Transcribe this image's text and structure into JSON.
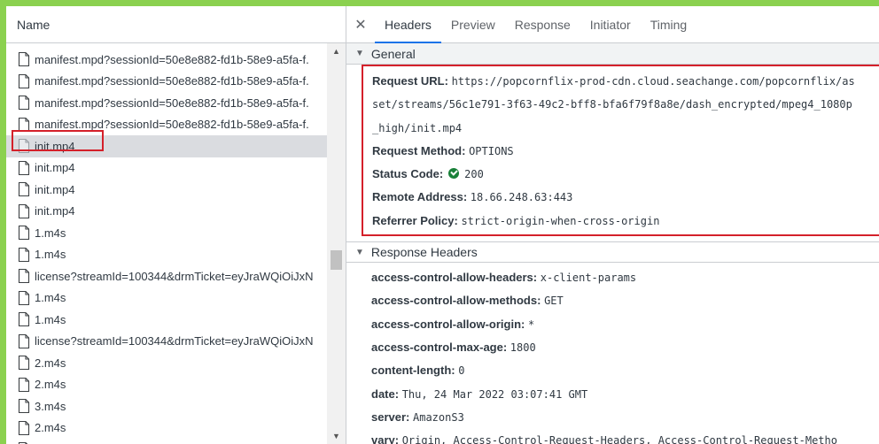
{
  "left": {
    "column_name": "Name",
    "requests": [
      {
        "name": "manifest.mpd?sessionId=50e8e882-fd1b-58e9-a5fa-f.",
        "selected": false
      },
      {
        "name": "manifest.mpd?sessionId=50e8e882-fd1b-58e9-a5fa-f.",
        "selected": false
      },
      {
        "name": "manifest.mpd?sessionId=50e8e882-fd1b-58e9-a5fa-f.",
        "selected": false
      },
      {
        "name": "manifest.mpd?sessionId=50e8e882-fd1b-58e9-a5fa-f.",
        "selected": false
      },
      {
        "name": "init.mp4",
        "selected": true
      },
      {
        "name": "init.mp4",
        "selected": false
      },
      {
        "name": "init.mp4",
        "selected": false
      },
      {
        "name": "init.mp4",
        "selected": false
      },
      {
        "name": "1.m4s",
        "selected": false
      },
      {
        "name": "1.m4s",
        "selected": false
      },
      {
        "name": "license?streamId=100344&drmTicket=eyJraWQiOiJxN",
        "selected": false
      },
      {
        "name": "1.m4s",
        "selected": false
      },
      {
        "name": "1.m4s",
        "selected": false
      },
      {
        "name": "license?streamId=100344&drmTicket=eyJraWQiOiJxN",
        "selected": false
      },
      {
        "name": "2.m4s",
        "selected": false
      },
      {
        "name": "2.m4s",
        "selected": false
      },
      {
        "name": "3.m4s",
        "selected": false
      },
      {
        "name": "2.m4s",
        "selected": false
      },
      {
        "name": "2.m4s",
        "selected": false
      }
    ]
  },
  "tabs": {
    "close": "✕",
    "headers": "Headers",
    "preview": "Preview",
    "response": "Response",
    "initiator": "Initiator",
    "timing": "Timing"
  },
  "general": {
    "title": "General",
    "request_url_label": "Request URL:",
    "request_url_line1": "https://popcornflix-prod-cdn.cloud.seachange.com/popcornflix/as",
    "request_url_line2": "set/streams/56c1e791-3f63-49c2-bff8-bfa6f79f8a8e/dash_encrypted/mpeg4_1080p",
    "request_url_line3": "_high/init.mp4",
    "method_label": "Request Method:",
    "method_value": "OPTIONS",
    "status_label": "Status Code:",
    "status_value": "200",
    "remote_label": "Remote Address:",
    "remote_value": "18.66.248.63:443",
    "referrer_label": "Referrer Policy:",
    "referrer_value": "strict-origin-when-cross-origin"
  },
  "response_headers": {
    "title": "Response Headers",
    "items": [
      {
        "key": "access-control-allow-headers:",
        "value": "x-client-params"
      },
      {
        "key": "access-control-allow-methods:",
        "value": "GET"
      },
      {
        "key": "access-control-allow-origin:",
        "value": "*"
      },
      {
        "key": "access-control-max-age:",
        "value": "1800"
      },
      {
        "key": "content-length:",
        "value": "0"
      },
      {
        "key": "date:",
        "value": "Thu, 24 Mar 2022 03:07:41 GMT"
      },
      {
        "key": "server:",
        "value": "AmazonS3"
      },
      {
        "key": "vary:",
        "value": "Origin, Access-Control-Request-Headers, Access-Control-Request-Metho"
      }
    ]
  },
  "colors": {
    "frame_green": "#8bd14f",
    "highlight_red": "#d4202a",
    "status_ok": "#188038",
    "tab_active": "#1a73e8"
  }
}
